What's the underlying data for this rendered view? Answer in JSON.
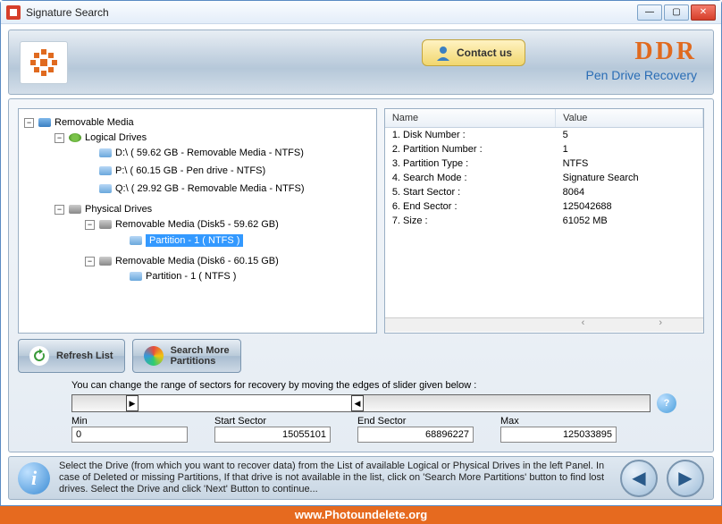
{
  "window": {
    "title": "Signature Search"
  },
  "header": {
    "contact_label": "Contact us",
    "brand": "DDR",
    "brand_sub": "Pen Drive Recovery"
  },
  "tree": {
    "root": "Removable Media",
    "logical_label": "Logical Drives",
    "logical": [
      "D:\\ ( 59.62 GB - Removable Media - NTFS)",
      "P:\\ ( 60.15 GB - Pen drive - NTFS)",
      "Q:\\ ( 29.92 GB - Removable Media - NTFS)"
    ],
    "physical_label": "Physical Drives",
    "physical": [
      {
        "name": "Removable Media (Disk5 - 59.62 GB)",
        "part": "Partition - 1 ( NTFS )",
        "selected": true
      },
      {
        "name": "Removable Media (Disk6 - 60.15 GB)",
        "part": "Partition - 1 ( NTFS )",
        "selected": false
      }
    ]
  },
  "table": {
    "col_name": "Name",
    "col_value": "Value",
    "rows": [
      {
        "name": "1. Disk Number :",
        "value": "5"
      },
      {
        "name": "2. Partition Number :",
        "value": "1"
      },
      {
        "name": "3. Partition Type :",
        "value": "NTFS"
      },
      {
        "name": "4. Search Mode :",
        "value": "Signature Search"
      },
      {
        "name": "5. Start Sector :",
        "value": "8064"
      },
      {
        "name": "6. End Sector :",
        "value": "125042688"
      },
      {
        "name": "7. Size :",
        "value": "61052 MB"
      }
    ]
  },
  "buttons": {
    "refresh": "Refresh List",
    "search_more1": "Search More",
    "search_more2": "Partitions"
  },
  "slider": {
    "label": "You can change the range of sectors for recovery by moving the edges of slider given below :",
    "min_label": "Min",
    "min": "0",
    "start_label": "Start Sector",
    "start": "15055101",
    "end_label": "End Sector",
    "end": "68896227",
    "max_label": "Max",
    "max": "125033895"
  },
  "footer": {
    "msg": "Select the Drive (from which you want to recover data) from the List of available Logical or Physical Drives in the left Panel. In case of Deleted or missing Partitions, If that drive is not available in the list, click on 'Search More Partitions' button to find lost drives. Select the Drive and click 'Next' Button to continue..."
  },
  "url": "www.Photoundelete.org"
}
